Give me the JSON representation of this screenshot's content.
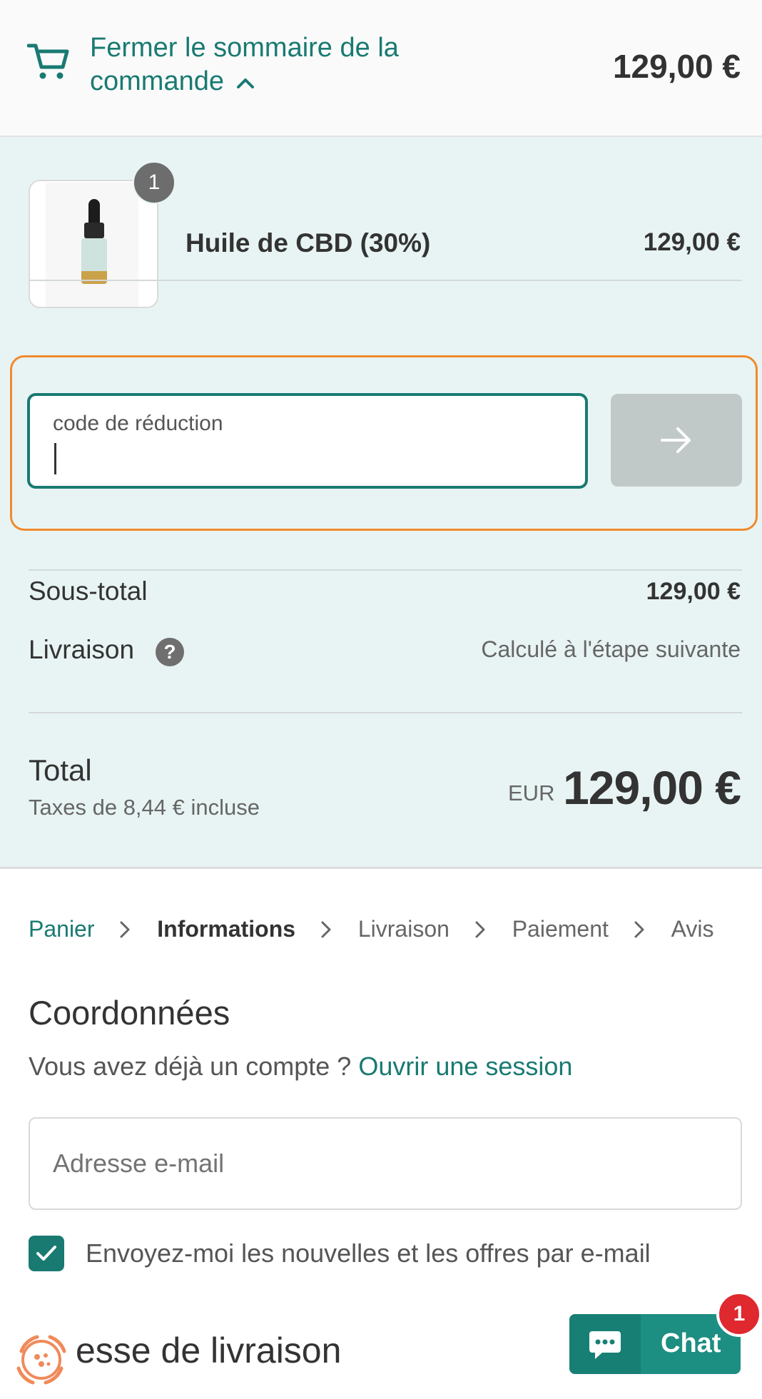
{
  "summary_toggle": {
    "label": "Fermer le sommaire de la commande",
    "total": "129,00 €"
  },
  "cart": {
    "items": [
      {
        "name": "Huile de CBD (30%)",
        "quantity": "1",
        "price": "129,00 €"
      }
    ]
  },
  "discount": {
    "label": "code de réduction",
    "value": ""
  },
  "totals": {
    "subtotal_label": "Sous-total",
    "subtotal_value": "129,00 €",
    "shipping_label": "Livraison",
    "shipping_value": "Calculé à l'étape suivante",
    "total_label": "Total",
    "tax_note": "Taxes de 8,44 € incluse",
    "currency": "EUR",
    "total_value": "129,00 €"
  },
  "breadcrumb": {
    "cart": "Panier",
    "information": "Informations",
    "shipping": "Livraison",
    "payment": "Paiement",
    "review": "Avis"
  },
  "contact": {
    "title": "Coordonnées",
    "account_prompt": "Vous avez déjà un compte ?",
    "login_link": "Ouvrir une session",
    "email_placeholder": "Adresse e-mail",
    "newsletter_label": "Envoyez-moi les nouvelles et les offres par e-mail",
    "newsletter_checked": true
  },
  "next_section": {
    "title": "esse de livraison"
  },
  "chat": {
    "label": "Chat",
    "badge": "1"
  },
  "colors": {
    "accent": "#197a72",
    "panel_bg": "#e8f4f3",
    "highlight_outline": "#f08a2d",
    "chat_bg": "#1d8e82",
    "badge_red": "#e0282f"
  },
  "icons": {
    "cart": "cart-icon",
    "toggle": "chevron-up-icon",
    "apply": "arrow-right-icon",
    "help": "question-icon",
    "breadcrumb_separator": "chevron-right-icon",
    "checkbox": "checkmark-icon",
    "chat": "chat-bubble-icon"
  }
}
